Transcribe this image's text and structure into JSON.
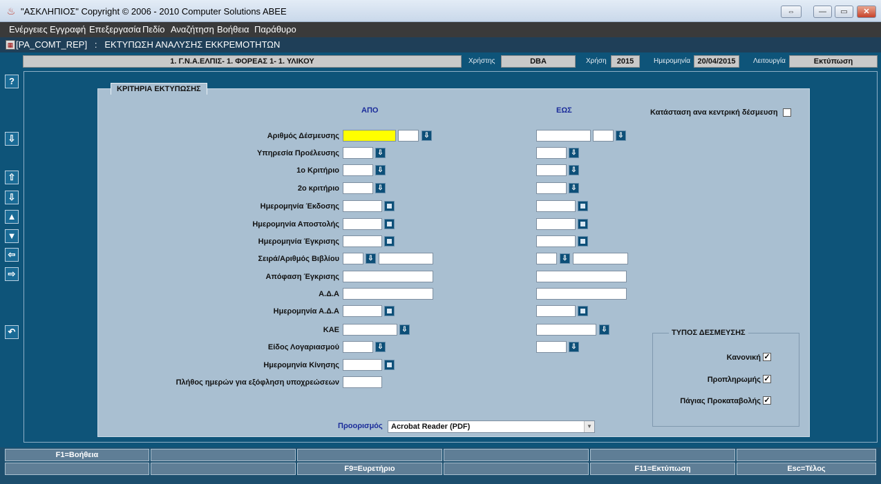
{
  "window": {
    "title": "\"ΑΣΚΛΗΠΙΟΣ\" Copyright © 2006 - 2010 Computer Solutions ABEE",
    "restore_glyph": "⇔",
    "min_glyph": "—",
    "max_glyph": "▭",
    "close_glyph": "✕"
  },
  "menu": [
    "Ενέργειες",
    "Εγγραφή",
    "Επεξεργασία",
    "Πεδίο",
    "Αναζήτηση",
    "Βοήθεια",
    "Παράθυρο"
  ],
  "form": {
    "code": "[PA_COMT_REP]",
    "separator": ":",
    "name": "ΕΚΤΥΠΩΣΗ ΑΝΑΛΥΣΗΣ ΕΚΚΡΕΜΟΤΗΤΩΝ"
  },
  "info": {
    "organization": "1. Γ.Ν.Α.ΕΛΠΙΣ- 1. ΦΟΡΕΑΣ 1- 1. ΥΛΙΚΟΥ",
    "user_label": "Χρήστης",
    "user": "DBA",
    "year_label": "Χρήση",
    "year": "2015",
    "date_label": "Ημερομηνία",
    "date": "20/04/2015",
    "function_label": "Λειτουργία",
    "function": "Εκτύπωση"
  },
  "toolbar_icons": [
    "help-icon",
    "lov-icon",
    "first-record-icon",
    "last-record-icon",
    "previous-record-icon",
    "next-record-icon",
    "previous-field-icon",
    "next-field-icon",
    "undo-icon"
  ],
  "criteria": {
    "title": "ΚΡΙΤΗΡΙΑ ΕΚΤΥΠΩΣΗΣ",
    "from_header": "ΑΠΟ",
    "to_header": "ΕΩΣ",
    "central_label": "Κατάσταση ανα κεντρική δέσμευση",
    "rows": [
      "Αριθμός Δέσμευσης",
      "Υπηρεσία Προέλευσης",
      "1ο Κριτήριο",
      "2ο κριτήριο",
      "Ημερομηνία Έκδοσης",
      "Ημερομηνία Αποστολής",
      "Ημερομηνία Έγκρισης",
      "Σειρά/Αριθμός Βιβλίου",
      "Απόφαση Έγκρισης",
      "Α.Δ.Α",
      "Ημερομηνία Α.Δ.Α",
      "ΚΑΕ",
      "Είδος Λογαριασμού",
      "Ημερομηνία Κίνησης",
      "Πλήθος ημερών για εξόφληση υποχρεώσεων"
    ]
  },
  "commitment_type": {
    "title": "ΤΥΠΟΣ ΔΕΣΜΕΥΣΗΣ",
    "options": [
      {
        "label": "Κανονική",
        "checked": true
      },
      {
        "label": "Προπληρωμής",
        "checked": true
      },
      {
        "label": "Πάγιας Προκαταβολής",
        "checked": true
      }
    ]
  },
  "destination": {
    "label": "Προορισμός",
    "value": "Acrobat Reader (PDF)"
  },
  "fkeys_row1": [
    "F1=Βοήθεια",
    "",
    "",
    "",
    "",
    ""
  ],
  "fkeys_row2": [
    "",
    "",
    "F9=Ευρετήριο",
    "",
    "F11=Εκτύπωση",
    "Esc=Τέλος"
  ],
  "colors": {
    "main_bg": "#0e5479",
    "panel_bg": "#a9bfd1",
    "active_field": "#ffff00",
    "header_blue": "#1a2b9a"
  }
}
